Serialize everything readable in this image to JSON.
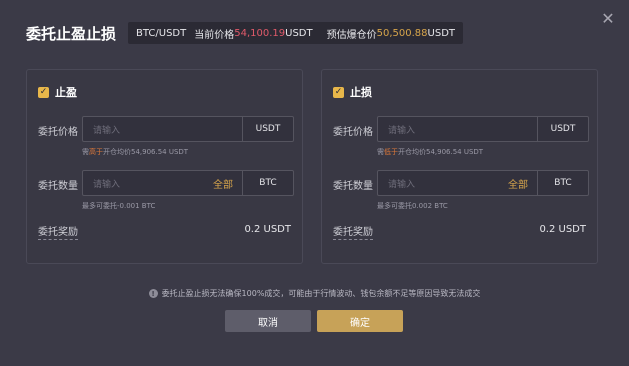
{
  "dialog": {
    "title": "委托止盈止损",
    "pair": "BTC/USDT",
    "current_price_label": "当前价格",
    "current_price_value": "54,100.19",
    "current_price_unit": "USDT",
    "liq_price_label": "预估爆仓价",
    "liq_price_value": "50,500.88",
    "liq_price_unit": "USDT",
    "close_icon": "close-icon"
  },
  "take_profit": {
    "checkbox_label": "止盈",
    "price_label": "委托价格",
    "price_placeholder": "请输入",
    "price_unit": "USDT",
    "price_hint_prefix": "需",
    "price_hint_highlight": "高于",
    "price_hint_suffix": "开仓均价54,906.54 USDT",
    "qty_label": "委托数量",
    "qty_placeholder": "请输入",
    "qty_all": "全部",
    "qty_unit": "BTC",
    "qty_hint": "最多可委托-0.001 BTC",
    "reward_label": "委托奖励",
    "reward_value": "0.2 USDT"
  },
  "stop_loss": {
    "checkbox_label": "止损",
    "price_label": "委托价格",
    "price_placeholder": "请输入",
    "price_unit": "USDT",
    "price_hint_prefix": "需",
    "price_hint_highlight": "低于",
    "price_hint_suffix": "开仓均价54,906.54 USDT",
    "qty_label": "委托数量",
    "qty_placeholder": "请输入",
    "qty_all": "全部",
    "qty_unit": "BTC",
    "qty_hint": "最多可委托0.002 BTC",
    "reward_label": "委托奖励",
    "reward_value": "0.2 USDT"
  },
  "notice": "委托止盈止损无法确保100%成交，可能由于行情波动、钱包余额不足等原因导致无法成交",
  "buttons": {
    "cancel": "取消",
    "confirm": "确定"
  },
  "colors": {
    "accent": "#d7a54b",
    "price_red": "#e05a6a",
    "confirm_bg": "#c7a258"
  }
}
